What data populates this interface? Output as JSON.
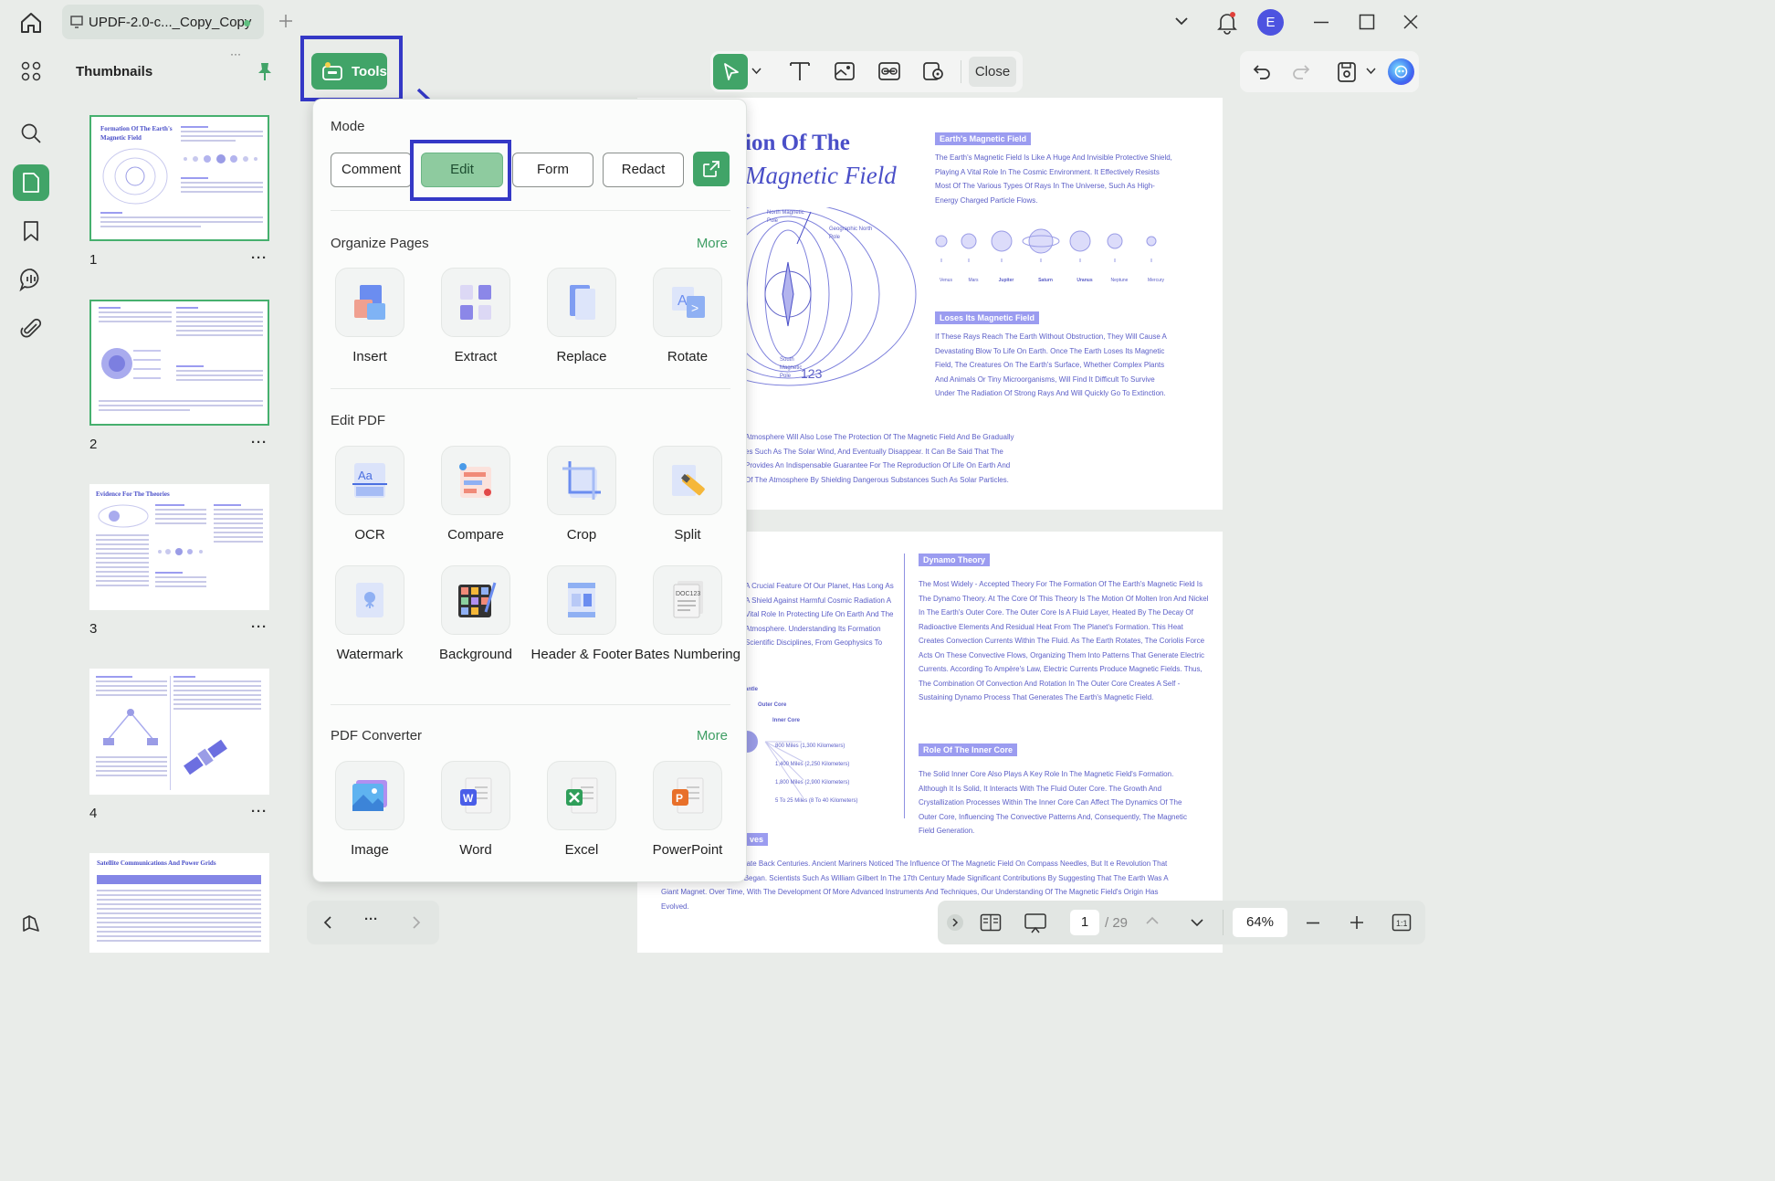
{
  "window": {
    "tab_title": "UPDF-2.0-c..._Copy_Copy",
    "avatar_letter": "E"
  },
  "thumbnails": {
    "title": "Thumbnails",
    "pages": [
      {
        "num": "1",
        "heading": "Formation Of The Earth's Magnetic Field"
      },
      {
        "num": "2",
        "heading": ""
      },
      {
        "num": "3",
        "heading": "Evidence For The Theories"
      },
      {
        "num": "4",
        "heading": ""
      },
      {
        "num": "",
        "heading": "Satellite Communications And Power Grids"
      }
    ],
    "more": "···"
  },
  "tools_button": "Tools",
  "toolbar": {
    "close": "Close"
  },
  "popup": {
    "mode_title": "Mode",
    "modes": [
      "Comment",
      "Edit",
      "Form",
      "Redact"
    ],
    "organize_title": "Organize Pages",
    "organize_more": "More",
    "organize_tools": [
      "Insert",
      "Extract",
      "Replace",
      "Rotate"
    ],
    "edit_title": "Edit PDF",
    "edit_tools": [
      "OCR",
      "Compare",
      "Crop",
      "Split",
      "Watermark",
      "Background",
      "Header & Footer",
      "Bates Numbering"
    ],
    "converter_title": "PDF Converter",
    "converter_more": "More",
    "converter_tools": [
      "Image",
      "Word",
      "Excel",
      "PowerPoint"
    ]
  },
  "document": {
    "page1": {
      "title_line1": "ion Of The",
      "title_line2": "Magnetic Field",
      "tag1": "Earth's Magnetic Field",
      "para1": "The Earth's Magnetic Field Is Like A Huge And Invisible Protective Shield, Playing A Vital Role In The Cosmic Environment. It Effectively Resists Most Of The Various Types Of Rays In The Universe, Such As High-Energy Charged Particle Flows.",
      "planets": [
        "Venus",
        "Mars",
        "Jupiter",
        "Saturn",
        "Uranus",
        "Neptune",
        "Mercury"
      ],
      "tag2": "Loses Its Magnetic Field",
      "para2": "If These Rays Reach The Earth Without Obstruction, They Will Cause A Devastating Blow To Life On Earth. Once The Earth Loses Its Magnetic Field, The Creatures On The Earth's Surface, Whether Complex Plants And Animals Or Tiny Microorganisms, Will Find It Difficult To Survive Under The Radiation Of Strong Rays And Will Quickly Go To Extinction.",
      "north_pole": "North Magnetic Pole",
      "geo_north": "Geographic North Pole",
      "south_pole": "South Magnetic Pole",
      "number": "123",
      "para3": "Atmosphere Will Also Lose The Protection Of The Magnetic Field And Be Gradually es Such As The Solar Wind, And Eventually Disappear. It Can Be Said That The Provides An Indispensable Guarantee For The Reproduction Of Life On Earth And Of The Atmosphere By Shielding Dangerous Substances Such As Solar Particles."
    },
    "page2": {
      "tag1": "Dynamo Theory",
      "para1": "The Most Widely - Accepted Theory For The Formation Of The Earth's Magnetic Field Is The Dynamo Theory. At The Core Of This Theory Is The Motion Of Molten Iron And Nickel In The Earth's Outer Core. The Outer Core Is A Fluid Layer, Heated By The Decay Of Radioactive Elements And Residual Heat From The Planet's Formation. This Heat Creates Convection Currents Within The Fluid. As The Earth Rotates, The Coriolis Force Acts On These Convective Flows, Organizing Them Into Patterns That Generate Electric Currents. According To Ampère's Law, Electric Currents Produce Magnetic Fields. Thus, The Combination Of Convection And Rotation In The Outer Core Creates A Self - Sustaining Dynamo Process That Generates The Earth's Magnetic Field.",
      "tag2": "Role Of The Inner Core",
      "para2": "The Solid Inner Core Also Plays A Key Role In The Magnetic Field's Formation. Although It Is Solid, It Interacts With The Fluid Outer Core. The Growth And Crystallization Processes Within The Inner Core Can Affect The Dynamics Of The Outer Core, Influencing The Convective Patterns And, Consequently, The Magnetic Field Generation.",
      "left_para": "A Crucial Feature Of Our Planet, Has Long As A Shield Against Harmful Cosmic Radiation A Vital Role In Protecting Life On Earth And The Atmosphere. Understanding Its Formation Scientific Disciplines, From Geophysics To",
      "mantle": "antle",
      "outer_core": "Outer Core",
      "inner_core": "Inner Core",
      "miles": [
        "800 Miles (1,300 Kilometers)",
        "1,400 Miles (2,250 Kilometers)",
        "1,800 Miles (2,900 Kilometers)",
        "5 To 25 Miles (8 To 40 Kilometers)"
      ],
      "tag3": "ves",
      "para3": "e Earth's Magnetic Field Date Back Centuries. Ancient Mariners Noticed The Influence Of The Magnetic Field On Compass Needles, But It e Revolution That More Systematic Studies Began. Scientists Such As William Gilbert In The 17th Century Made Significant Contributions By Suggesting That The Earth Was A Giant Magnet. Over Time, With The Development Of More Advanced Instruments And Techniques, Our Understanding Of The Magnetic Field's Origin Has Evolved."
    }
  },
  "pager": {
    "more": "···"
  },
  "bottom_bar": {
    "page_current": "1",
    "page_total": "/ 29",
    "zoom": "64%"
  },
  "colors": {
    "accent": "#41a468",
    "highlight": "#3438c6",
    "doc_blue": "#4a4fc8"
  }
}
